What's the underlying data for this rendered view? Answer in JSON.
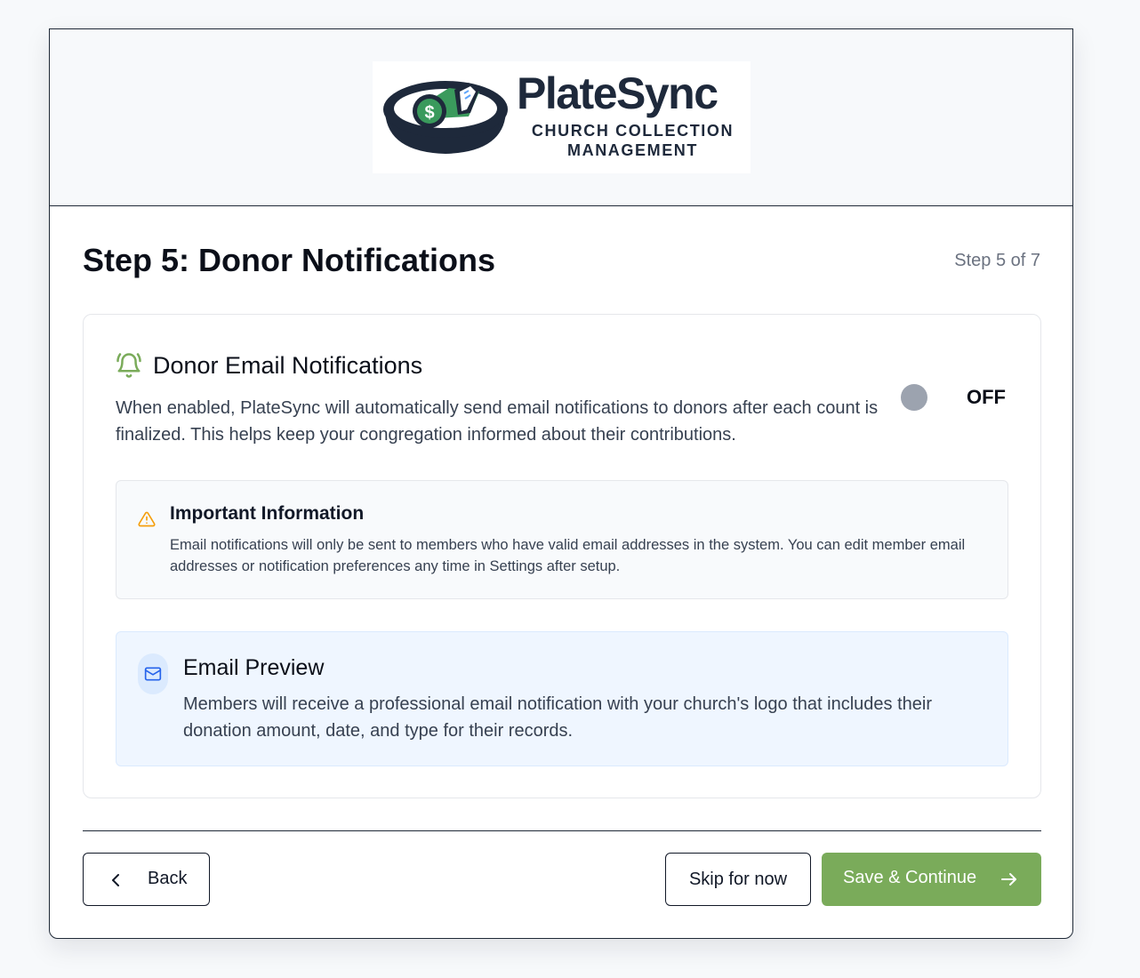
{
  "brand": {
    "name": "PlateSync",
    "tagline": "CHURCH COLLECTION MANAGEMENT",
    "logo_icon": "collection-plate-with-money",
    "colors": {
      "navy": "#1e293b",
      "green": "#3a9a5c"
    }
  },
  "step": {
    "title": "Step 5: Donor Notifications",
    "progress": "Step 5 of 7"
  },
  "notifications": {
    "icon": "bell-ring-icon",
    "title": "Donor Email Notifications",
    "description": "When enabled, PlateSync will automatically send email notifications to donors after each count is finalized. This helps keep your congregation informed about their contributions.",
    "toggle_enabled": false,
    "toggle_label": "OFF"
  },
  "important": {
    "icon": "warning-triangle-icon",
    "title": "Important Information",
    "text": "Email notifications will only be sent to members who have valid email addresses in the system. You can edit member email addresses or notification preferences any time in Settings after setup."
  },
  "preview": {
    "icon": "mail-icon",
    "title": "Email Preview",
    "text": "Members will receive a professional email notification with your church's logo that includes their donation amount, date, and type for their records."
  },
  "footer": {
    "back_label": "Back",
    "skip_label": "Skip for now",
    "save_label": "Save & Continue"
  },
  "colors": {
    "accent_green": "#7aab5a",
    "warning_orange": "#f59e0b",
    "info_blue": "#2563eb",
    "toggle_off": "#9ca3af"
  }
}
